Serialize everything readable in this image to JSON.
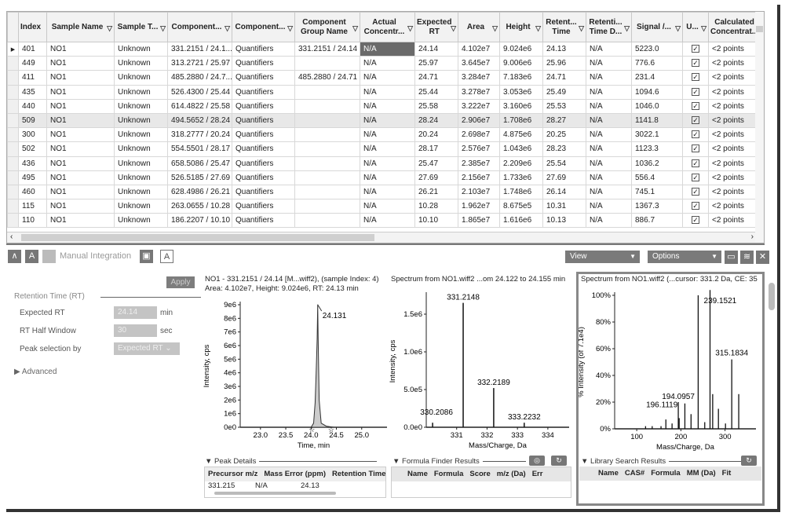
{
  "grid": {
    "columns": [
      {
        "label": "Index",
        "filter": false
      },
      {
        "label": "Sample Name",
        "filter": true
      },
      {
        "label": "Sample T...",
        "filter": true
      },
      {
        "label": "Component...",
        "filter": true
      },
      {
        "label": "Component...",
        "filter": true
      },
      {
        "label": "Component Group Name",
        "filter": true
      },
      {
        "label": "Actual Concentr...",
        "filter": true
      },
      {
        "label": "Expected RT",
        "filter": true
      },
      {
        "label": "Area",
        "filter": true
      },
      {
        "label": "Height",
        "filter": true
      },
      {
        "label": "Retent... Time",
        "filter": true
      },
      {
        "label": "Retenti... Time D...",
        "filter": true
      },
      {
        "label": "Signal /...",
        "filter": true
      },
      {
        "label": "U...",
        "filter": true
      },
      {
        "label": "Calculated Concentrat...",
        "filter": false
      }
    ],
    "rows": [
      [
        "401",
        "NO1",
        "Unknown",
        "331.2151 / 24.1...",
        "Quantifiers",
        "331.2151 / 24.14",
        "N/A",
        "24.14",
        "4.102e7",
        "9.024e6",
        "24.13",
        "N/A",
        "5223.0",
        "checked",
        "<2 points"
      ],
      [
        "449",
        "NO1",
        "Unknown",
        "313.2721 / 25.97",
        "Quantifiers",
        "",
        "N/A",
        "25.97",
        "3.645e7",
        "9.006e6",
        "25.96",
        "N/A",
        "776.6",
        "checked",
        "<2 points"
      ],
      [
        "411",
        "NO1",
        "Unknown",
        "485.2880 / 24.7...",
        "Quantifiers",
        "485.2880 / 24.71",
        "N/A",
        "24.71",
        "3.284e7",
        "7.183e6",
        "24.71",
        "N/A",
        "231.4",
        "checked",
        "<2 points"
      ],
      [
        "435",
        "NO1",
        "Unknown",
        "526.4300 / 25.44",
        "Quantifiers",
        "",
        "N/A",
        "25.44",
        "3.278e7",
        "3.053e6",
        "25.49",
        "N/A",
        "1094.6",
        "checked",
        "<2 points"
      ],
      [
        "440",
        "NO1",
        "Unknown",
        "614.4822 / 25.58",
        "Quantifiers",
        "",
        "N/A",
        "25.58",
        "3.222e7",
        "3.160e6",
        "25.53",
        "N/A",
        "1046.0",
        "checked",
        "<2 points"
      ],
      [
        "509",
        "NO1",
        "Unknown",
        "494.5652 / 28.24",
        "Quantifiers",
        "",
        "N/A",
        "28.24",
        "2.906e7",
        "1.708e6",
        "28.27",
        "N/A",
        "1141.8",
        "checked",
        "<2 points"
      ],
      [
        "300",
        "NO1",
        "Unknown",
        "318.2777 / 20.24",
        "Quantifiers",
        "",
        "N/A",
        "20.24",
        "2.698e7",
        "4.875e6",
        "20.25",
        "N/A",
        "3022.1",
        "checked",
        "<2 points"
      ],
      [
        "502",
        "NO1",
        "Unknown",
        "554.5501 / 28.17",
        "Quantifiers",
        "",
        "N/A",
        "28.17",
        "2.576e7",
        "1.043e6",
        "28.23",
        "N/A",
        "1123.3",
        "checked",
        "<2 points"
      ],
      [
        "436",
        "NO1",
        "Unknown",
        "658.5086 / 25.47",
        "Quantifiers",
        "",
        "N/A",
        "25.47",
        "2.385e7",
        "2.209e6",
        "25.54",
        "N/A",
        "1036.2",
        "checked",
        "<2 points"
      ],
      [
        "495",
        "NO1",
        "Unknown",
        "526.5185 / 27.69",
        "Quantifiers",
        "",
        "N/A",
        "27.69",
        "2.156e7",
        "1.733e6",
        "27.69",
        "N/A",
        "556.4",
        "checked",
        "<2 points"
      ],
      [
        "460",
        "NO1",
        "Unknown",
        "628.4986 / 26.21",
        "Quantifiers",
        "",
        "N/A",
        "26.21",
        "2.103e7",
        "1.748e6",
        "26.14",
        "N/A",
        "745.1",
        "checked",
        "<2 points"
      ],
      [
        "115",
        "NO1",
        "Unknown",
        "263.0655 / 10.28",
        "Quantifiers",
        "",
        "N/A",
        "10.28",
        "1.962e7",
        "8.675e5",
        "10.31",
        "N/A",
        "1367.3",
        "checked",
        "<2 points"
      ],
      [
        "110",
        "NO1",
        "Unknown",
        "186.2207 / 10.10",
        "Quantifiers",
        "",
        "N/A",
        "10.10",
        "1.865e7",
        "1.616e6",
        "10.13",
        "N/A",
        "886.7",
        "checked",
        "<2 points"
      ]
    ],
    "selected_row": 0,
    "highlighted_row": 5
  },
  "toolbar": {
    "manual_integration": "Manual Integration",
    "view": "View",
    "options": "Options"
  },
  "integration": {
    "apply": "Apply",
    "section": "Retention Time (RT)",
    "expected_rt_label": "Expected RT",
    "expected_rt_value": "24.14",
    "expected_rt_unit": "min",
    "half_window_label": "RT Half Window",
    "half_window_value": "30",
    "half_window_unit": "sec",
    "peak_sel_label": "Peak selection by",
    "peak_sel_value": "Expected RT",
    "advanced": "Advanced"
  },
  "xic": {
    "title1": "NO1 - 331.2151 / 24.14  [M...wiff2), (sample Index: 4)",
    "title2": "Area: 4.102e7, Height: 9.024e6, RT: 24.13 min"
  },
  "ms": {
    "title": "Spectrum from NO1.wiff2 ...om 24.122 to 24.155 min"
  },
  "msms": {
    "title": "Spectrum from NO1.wiff2 (...cursor: 331.2 Da, CE: 35"
  },
  "chart_data": [
    {
      "type": "area",
      "title": "NO1 - 331.2151 / 24.14",
      "xlabel": "Time, min",
      "ylabel": "Intensity, cps",
      "xlim": [
        22.6,
        25.5
      ],
      "ylim": [
        0,
        9000000
      ],
      "xticks": [
        "23.0",
        "23.5",
        "24.0",
        "24.5",
        "25.0"
      ],
      "yticks": [
        "0e0",
        "1e6",
        "2e6",
        "3e6",
        "4e6",
        "5e6",
        "6e6",
        "7e6",
        "8e6",
        "9e6"
      ],
      "x": [
        22.6,
        24.0,
        24.05,
        24.08,
        24.1,
        24.12,
        24.131,
        24.14,
        24.16,
        24.2,
        24.3,
        24.45,
        25.5
      ],
      "y": [
        0,
        0,
        300000,
        1800000,
        4000000,
        6500000,
        9024000,
        6500000,
        2000000,
        300000,
        80000,
        0,
        0
      ],
      "annotations": [
        {
          "x": 24.131,
          "label": "24.131"
        }
      ]
    },
    {
      "type": "bar",
      "title": "Spectrum from NO1.wiff2 ...om 24.122 to 24.155 min",
      "xlabel": "Mass/Charge, Da",
      "ylabel": "Intensity, cps",
      "xlim": [
        330.0,
        334.7
      ],
      "ylim": [
        0,
        1750000
      ],
      "xticks": [
        "331",
        "332",
        "333",
        "334"
      ],
      "yticks": [
        "0.0e0",
        "5.0e5",
        "1.0e6",
        "1.5e6"
      ],
      "x": [
        330.2086,
        331.2148,
        332.2189,
        333.2232
      ],
      "values": [
        60000,
        1650000,
        520000,
        60000
      ],
      "labels": [
        "330.2086",
        "331.2148",
        "332.2189",
        "333.2232"
      ]
    },
    {
      "type": "bar",
      "title": "Spectrum from NO1.wiff2 (...cursor: 331.2 Da, CE: 35",
      "xlabel": "Mass/Charge, Da",
      "ylabel": "% Intensity (of 7.1e4)",
      "xlim": [
        50,
        370
      ],
      "ylim": [
        0,
        100
      ],
      "xticks": [
        "100",
        "200",
        "300"
      ],
      "yticks": [
        "0%",
        "20%",
        "40%",
        "60%",
        "80%",
        "100%"
      ],
      "x": [
        120,
        135,
        155,
        166,
        180,
        194.0957,
        196.1119,
        209,
        223,
        239.1521,
        254,
        266,
        272,
        285,
        301,
        315.1834,
        331
      ],
      "values": [
        2,
        2,
        2,
        7,
        4,
        20,
        8,
        19,
        11,
        100,
        5,
        104,
        26,
        15,
        4,
        52,
        26
      ],
      "labels": [
        "",
        "",
        "",
        "",
        "",
        "194.0957",
        "196.1119",
        "",
        "",
        "239.1521",
        "",
        "",
        "",
        "",
        "",
        "315.1834",
        ""
      ]
    }
  ],
  "peak_details": {
    "title": "Peak Details",
    "headers": [
      "Precursor m/z",
      "Mass Error (ppm)",
      "Retention Time ("
    ],
    "row": [
      "331.215",
      "N/A",
      "24.13"
    ]
  },
  "formula_finder": {
    "title": "Formula Finder Results",
    "headers": [
      "Name",
      "Formula",
      "Score",
      "m/z (Da)",
      "Err"
    ]
  },
  "library": {
    "title": "Library Search Results",
    "headers": [
      "Name",
      "CAS#",
      "Formula",
      "MM (Da)",
      "Fit"
    ]
  }
}
